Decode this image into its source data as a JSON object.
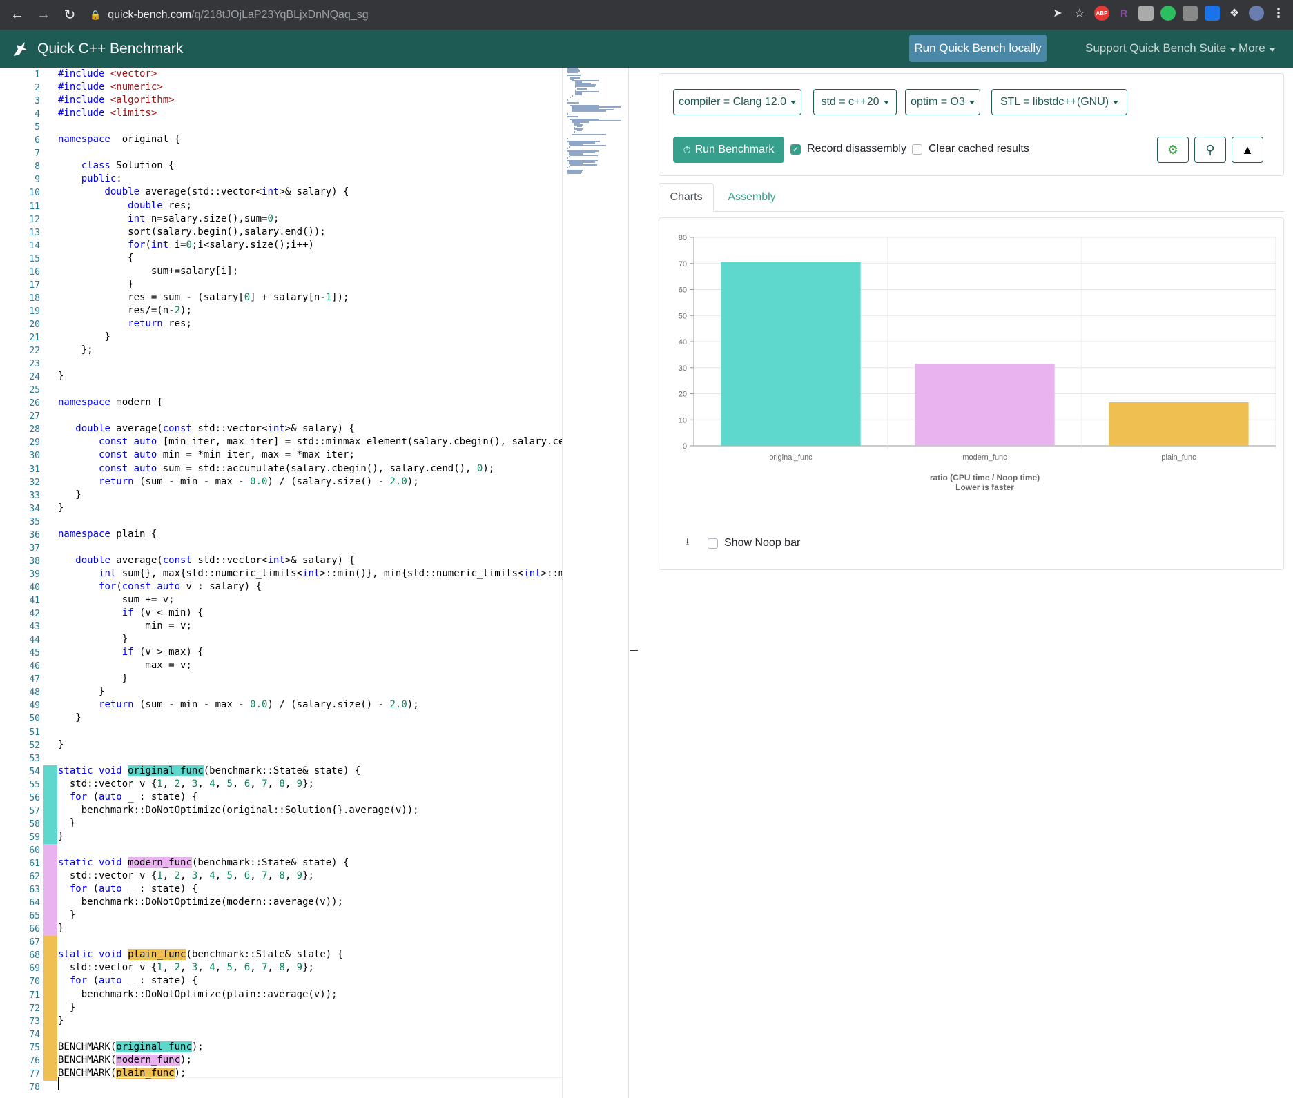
{
  "browser": {
    "url_host": "quick-bench.com",
    "url_path": "/q/218tJOjLaP23YqBLjxDnNQaq_sg",
    "ext_abp": "ABP",
    "ext_r": "R"
  },
  "app": {
    "title": "Quick C++ Benchmark",
    "run_local": "Run Quick Bench locally",
    "support_menu": "Support Quick Bench Suite",
    "more_menu": "More"
  },
  "controls": {
    "compiler": "compiler = Clang 12.0",
    "std": "std = c++20",
    "optim": "optim = O3",
    "stl": "STL = libstdc++(GNU)",
    "run_benchmark": "Run Benchmark",
    "record_disassembly": "Record disassembly",
    "record_disassembly_checked": true,
    "clear_cache": "Clear cached results",
    "clear_cache_checked": false
  },
  "tabs": {
    "charts": "Charts",
    "assembly": "Assembly"
  },
  "noop": {
    "label": "Show Noop bar",
    "checked": false
  },
  "colors": {
    "original": "#5ed8cc",
    "modern": "#e8b3ee",
    "plain": "#efc051",
    "navbar": "#1f5b55",
    "accent": "#37a08c"
  },
  "chart_data": {
    "type": "bar",
    "categories": [
      "original_func",
      "modern_func",
      "plain_func"
    ],
    "values": [
      70.5,
      31.5,
      16.7
    ],
    "colors": [
      "#5ed8cc",
      "#e8b3ee",
      "#efc051"
    ],
    "yticks": [
      0,
      10,
      20,
      30,
      40,
      50,
      60,
      70,
      80
    ],
    "ylim": [
      0,
      80
    ],
    "xlabel_line1": "ratio (CPU time / Noop time)",
    "xlabel_line2": "Lower is faster",
    "grid": true
  },
  "code": [
    [
      [
        "kw",
        "#include "
      ],
      [
        "str",
        "<vector>"
      ]
    ],
    [
      [
        "kw",
        "#include "
      ],
      [
        "str",
        "<numeric>"
      ]
    ],
    [
      [
        "kw",
        "#include "
      ],
      [
        "str",
        "<algorithm>"
      ]
    ],
    [
      [
        "kw",
        "#include "
      ],
      [
        "str",
        "<limits>"
      ]
    ],
    [],
    [
      [
        "kw",
        "namespace"
      ],
      [
        "",
        "  original {"
      ]
    ],
    [],
    [
      [
        "",
        "    "
      ],
      [
        "kw",
        "class"
      ],
      [
        "",
        " Solution {"
      ]
    ],
    [
      [
        "",
        "    "
      ],
      [
        "kw",
        "public"
      ],
      [
        "",
        ":"
      ]
    ],
    [
      [
        "",
        "        "
      ],
      [
        "kw",
        "double"
      ],
      [
        "",
        " average(std::vector<"
      ],
      [
        "kw",
        "int"
      ],
      [
        "",
        ">& salary) {"
      ]
    ],
    [
      [
        "",
        "            "
      ],
      [
        "kw",
        "double"
      ],
      [
        "",
        " res;"
      ]
    ],
    [
      [
        "",
        "            "
      ],
      [
        "kw",
        "int"
      ],
      [
        "",
        " n=salary.size(),sum="
      ],
      [
        "num",
        "0"
      ],
      [
        "",
        ";"
      ]
    ],
    [
      [
        "",
        "            sort(salary.begin(),salary.end());"
      ]
    ],
    [
      [
        "",
        "            "
      ],
      [
        "kw",
        "for"
      ],
      [
        "",
        "("
      ],
      [
        "kw",
        "int"
      ],
      [
        "",
        " i="
      ],
      [
        "num",
        "0"
      ],
      [
        "",
        ";i<salary.size();i++)"
      ]
    ],
    [
      [
        "",
        "            {"
      ]
    ],
    [
      [
        "",
        "                sum+=salary[i];"
      ]
    ],
    [
      [
        "",
        "            }"
      ]
    ],
    [
      [
        "",
        "            res = sum - (salary["
      ],
      [
        "num",
        "0"
      ],
      [
        "",
        "] + salary[n-"
      ],
      [
        "num",
        "1"
      ],
      [
        "",
        "]);"
      ]
    ],
    [
      [
        "",
        "            res/=(n-"
      ],
      [
        "num",
        "2"
      ],
      [
        "",
        ");"
      ]
    ],
    [
      [
        "",
        "            "
      ],
      [
        "kw",
        "return"
      ],
      [
        "",
        " res;"
      ]
    ],
    [
      [
        "",
        "        }"
      ]
    ],
    [
      [
        "",
        "    };"
      ]
    ],
    [],
    [
      [
        "",
        "}"
      ]
    ],
    [],
    [
      [
        "kw",
        "namespace"
      ],
      [
        "",
        " modern {"
      ]
    ],
    [],
    [
      [
        "",
        "   "
      ],
      [
        "kw",
        "double"
      ],
      [
        "",
        " average("
      ],
      [
        "kw",
        "const"
      ],
      [
        "",
        " std::vector<"
      ],
      [
        "kw",
        "int"
      ],
      [
        "",
        ">& salary) {"
      ]
    ],
    [
      [
        "",
        "       "
      ],
      [
        "kw",
        "const"
      ],
      [
        "",
        " "
      ],
      [
        "kw",
        "auto"
      ],
      [
        "",
        " [min_iter, max_iter] = std::minmax_element(salary.cbegin(), salary.ce"
      ]
    ],
    [
      [
        "",
        "       "
      ],
      [
        "kw",
        "const"
      ],
      [
        "",
        " "
      ],
      [
        "kw",
        "auto"
      ],
      [
        "",
        " min = *min_iter, max = *max_iter;"
      ]
    ],
    [
      [
        "",
        "       "
      ],
      [
        "kw",
        "const"
      ],
      [
        "",
        " "
      ],
      [
        "kw",
        "auto"
      ],
      [
        "",
        " sum = std::accumulate(salary.cbegin(), salary.cend(), "
      ],
      [
        "num",
        "0"
      ],
      [
        "",
        ");"
      ]
    ],
    [
      [
        "",
        "       "
      ],
      [
        "kw",
        "return"
      ],
      [
        "",
        " (sum - min - max - "
      ],
      [
        "num",
        "0.0"
      ],
      [
        "",
        ") / (salary.size() - "
      ],
      [
        "num",
        "2.0"
      ],
      [
        "",
        ");"
      ]
    ],
    [
      [
        "",
        "   }"
      ]
    ],
    [
      [
        "",
        "}"
      ]
    ],
    [],
    [
      [
        "kw",
        "namespace"
      ],
      [
        "",
        " plain {"
      ]
    ],
    [],
    [
      [
        "",
        "   "
      ],
      [
        "kw",
        "double"
      ],
      [
        "",
        " average("
      ],
      [
        "kw",
        "const"
      ],
      [
        "",
        " std::vector<"
      ],
      [
        "kw",
        "int"
      ],
      [
        "",
        ">& salary) {"
      ]
    ],
    [
      [
        "",
        "       "
      ],
      [
        "kw",
        "int"
      ],
      [
        "",
        " sum{}, max{std::numeric_limits<"
      ],
      [
        "kw",
        "int"
      ],
      [
        "",
        ">::min()}, min{std::numeric_limits<"
      ],
      [
        "kw",
        "int"
      ],
      [
        "",
        ">::m"
      ]
    ],
    [
      [
        "",
        "       "
      ],
      [
        "kw",
        "for"
      ],
      [
        "",
        "("
      ],
      [
        "kw",
        "const"
      ],
      [
        "",
        " "
      ],
      [
        "kw",
        "auto"
      ],
      [
        "",
        " v : salary) {"
      ]
    ],
    [
      [
        "",
        "           sum += v;"
      ]
    ],
    [
      [
        "",
        "           "
      ],
      [
        "kw",
        "if"
      ],
      [
        "",
        " (v < min) {"
      ]
    ],
    [
      [
        "",
        "               min = v;"
      ]
    ],
    [
      [
        "",
        "           }"
      ]
    ],
    [
      [
        "",
        "           "
      ],
      [
        "kw",
        "if"
      ],
      [
        "",
        " (v > max) {"
      ]
    ],
    [
      [
        "",
        "               max = v;"
      ]
    ],
    [
      [
        "",
        "           }"
      ]
    ],
    [
      [
        "",
        "       }"
      ]
    ],
    [
      [
        "",
        "       "
      ],
      [
        "kw",
        "return"
      ],
      [
        "",
        " (sum - min - max - "
      ],
      [
        "num",
        "0.0"
      ],
      [
        "",
        ") / (salary.size() - "
      ],
      [
        "num",
        "2.0"
      ],
      [
        "",
        ");"
      ]
    ],
    [
      [
        "",
        "   }"
      ]
    ],
    [],
    [
      [
        "",
        "}"
      ]
    ],
    [],
    [
      [
        "kw",
        "static"
      ],
      [
        "",
        " "
      ],
      [
        "kw",
        "void"
      ],
      [
        "",
        " "
      ],
      [
        "hl-o",
        "original_func"
      ],
      [
        "",
        "(benchmark::State& state) {"
      ]
    ],
    [
      [
        "",
        "  std::vector v {"
      ],
      [
        "num",
        "1"
      ],
      [
        "",
        ", "
      ],
      [
        "num",
        "2"
      ],
      [
        "",
        ", "
      ],
      [
        "num",
        "3"
      ],
      [
        "",
        ", "
      ],
      [
        "num",
        "4"
      ],
      [
        "",
        ", "
      ],
      [
        "num",
        "5"
      ],
      [
        "",
        ", "
      ],
      [
        "num",
        "6"
      ],
      [
        "",
        ", "
      ],
      [
        "num",
        "7"
      ],
      [
        "",
        ", "
      ],
      [
        "num",
        "8"
      ],
      [
        "",
        ", "
      ],
      [
        "num",
        "9"
      ],
      [
        "",
        "};"
      ]
    ],
    [
      [
        "",
        "  "
      ],
      [
        "kw",
        "for"
      ],
      [
        "",
        " ("
      ],
      [
        "kw",
        "auto"
      ],
      [
        "",
        " _ : state) {"
      ]
    ],
    [
      [
        "",
        "    benchmark::DoNotOptimize(original::Solution{}.average(v));"
      ]
    ],
    [
      [
        "",
        "  }"
      ]
    ],
    [
      [
        "",
        "}"
      ]
    ],
    [],
    [
      [
        "kw",
        "static"
      ],
      [
        "",
        " "
      ],
      [
        "kw",
        "void"
      ],
      [
        "",
        " "
      ],
      [
        "hl-m",
        "modern_func"
      ],
      [
        "",
        "(benchmark::State& state) {"
      ]
    ],
    [
      [
        "",
        "  std::vector v {"
      ],
      [
        "num",
        "1"
      ],
      [
        "",
        ", "
      ],
      [
        "num",
        "2"
      ],
      [
        "",
        ", "
      ],
      [
        "num",
        "3"
      ],
      [
        "",
        ", "
      ],
      [
        "num",
        "4"
      ],
      [
        "",
        ", "
      ],
      [
        "num",
        "5"
      ],
      [
        "",
        ", "
      ],
      [
        "num",
        "6"
      ],
      [
        "",
        ", "
      ],
      [
        "num",
        "7"
      ],
      [
        "",
        ", "
      ],
      [
        "num",
        "8"
      ],
      [
        "",
        ", "
      ],
      [
        "num",
        "9"
      ],
      [
        "",
        "};"
      ]
    ],
    [
      [
        "",
        "  "
      ],
      [
        "kw",
        "for"
      ],
      [
        "",
        " ("
      ],
      [
        "kw",
        "auto"
      ],
      [
        "",
        " _ : state) {"
      ]
    ],
    [
      [
        "",
        "    benchmark::DoNotOptimize(modern::average(v));"
      ]
    ],
    [
      [
        "",
        "  }"
      ]
    ],
    [
      [
        "",
        "}"
      ]
    ],
    [],
    [
      [
        "kw",
        "static"
      ],
      [
        "",
        " "
      ],
      [
        "kw",
        "void"
      ],
      [
        "",
        " "
      ],
      [
        "hl-p",
        "plain_func"
      ],
      [
        "",
        "(benchmark::State& state) {"
      ]
    ],
    [
      [
        "",
        "  std::vector v {"
      ],
      [
        "num",
        "1"
      ],
      [
        "",
        ", "
      ],
      [
        "num",
        "2"
      ],
      [
        "",
        ", "
      ],
      [
        "num",
        "3"
      ],
      [
        "",
        ", "
      ],
      [
        "num",
        "4"
      ],
      [
        "",
        ", "
      ],
      [
        "num",
        "5"
      ],
      [
        "",
        ", "
      ],
      [
        "num",
        "6"
      ],
      [
        "",
        ", "
      ],
      [
        "num",
        "7"
      ],
      [
        "",
        ", "
      ],
      [
        "num",
        "8"
      ],
      [
        "",
        ", "
      ],
      [
        "num",
        "9"
      ],
      [
        "",
        "};"
      ]
    ],
    [
      [
        "",
        "  "
      ],
      [
        "kw",
        "for"
      ],
      [
        "",
        " ("
      ],
      [
        "kw",
        "auto"
      ],
      [
        "",
        " _ : state) {"
      ]
    ],
    [
      [
        "",
        "    benchmark::DoNotOptimize(plain::average(v));"
      ]
    ],
    [
      [
        "",
        "  }"
      ]
    ],
    [
      [
        "",
        "}"
      ]
    ],
    [],
    [
      [
        "",
        "BENCHMARK("
      ],
      [
        "hl-o",
        "original_func"
      ],
      [
        "",
        ");"
      ]
    ],
    [
      [
        "",
        "BENCHMARK("
      ],
      [
        "hl-m",
        "modern_func"
      ],
      [
        "",
        ");"
      ]
    ],
    [
      [
        "",
        "BENCHMARK("
      ],
      [
        "hl-p",
        "plain_func"
      ],
      [
        "",
        ");"
      ]
    ],
    []
  ]
}
